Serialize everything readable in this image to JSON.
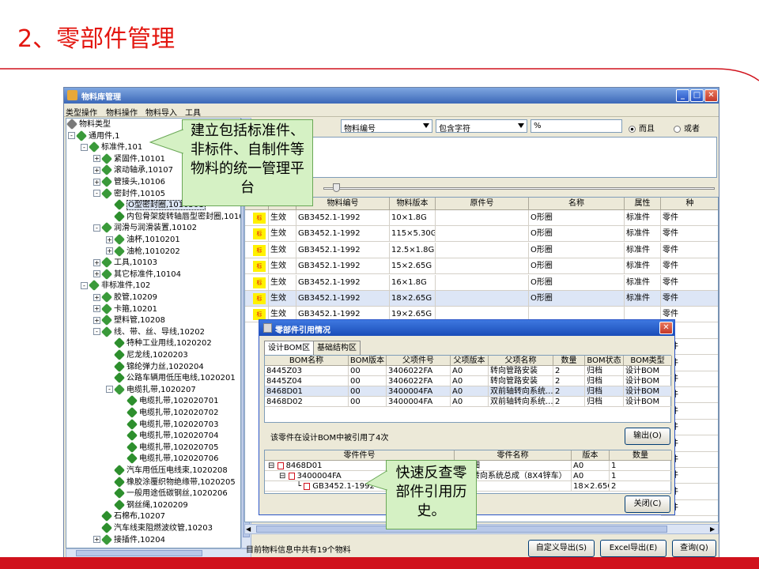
{
  "slide": {
    "title": "2、零部件管理"
  },
  "window": {
    "title": "物料库管理",
    "controls": [
      "_",
      "□",
      "✕"
    ],
    "menu": [
      "类型操作",
      "物料操作",
      "物料导入",
      "工具"
    ]
  },
  "tree": [
    {
      "label": "物料类型",
      "depth": 0,
      "box": "",
      "icon": "root"
    },
    {
      "label": "通用件,1",
      "depth": 0,
      "box": "-",
      "icon": "node"
    },
    {
      "label": "标准件,101",
      "depth": 1,
      "box": "-",
      "icon": "node"
    },
    {
      "label": "紧固件,10101",
      "depth": 2,
      "box": "+",
      "icon": "node"
    },
    {
      "label": "滚动轴承,10107",
      "depth": 2,
      "box": "+",
      "icon": "node"
    },
    {
      "label": "管接头,10106",
      "depth": 2,
      "box": "+",
      "icon": "node"
    },
    {
      "label": "密封件,10105",
      "depth": 2,
      "box": "-",
      "icon": "node"
    },
    {
      "label": "O型密封圈,1010501",
      "depth": 3,
      "box": "",
      "icon": "leaf",
      "selected": true
    },
    {
      "label": "内包骨架旋转轴唇型密封圈,1010502",
      "depth": 3,
      "box": "",
      "icon": "leaf"
    },
    {
      "label": "润滑与润滑装置,10102",
      "depth": 2,
      "box": "-",
      "icon": "node"
    },
    {
      "label": "油杯,1010201",
      "depth": 3,
      "box": "+",
      "icon": "node"
    },
    {
      "label": "油枪,1010202",
      "depth": 3,
      "box": "+",
      "icon": "node"
    },
    {
      "label": "工具,10103",
      "depth": 2,
      "box": "+",
      "icon": "node"
    },
    {
      "label": "其它标准件,10104",
      "depth": 2,
      "box": "+",
      "icon": "node"
    },
    {
      "label": "非标准件,102",
      "depth": 1,
      "box": "-",
      "icon": "node"
    },
    {
      "label": "胶管,10209",
      "depth": 2,
      "box": "+",
      "icon": "node"
    },
    {
      "label": "卡箍,10201",
      "depth": 2,
      "box": "+",
      "icon": "node"
    },
    {
      "label": "塑料管,10208",
      "depth": 2,
      "box": "+",
      "icon": "node"
    },
    {
      "label": "线、带、丝、导线,10202",
      "depth": 2,
      "box": "-",
      "icon": "node"
    },
    {
      "label": "特种工业用线,1020202",
      "depth": 3,
      "box": "",
      "icon": "leaf"
    },
    {
      "label": "尼龙线,1020203",
      "depth": 3,
      "box": "",
      "icon": "leaf"
    },
    {
      "label": "锦纶弹力丝,1020204",
      "depth": 3,
      "box": "",
      "icon": "leaf"
    },
    {
      "label": "公路车辆用低压电线,1020201",
      "depth": 3,
      "box": "",
      "icon": "leaf"
    },
    {
      "label": "电缆扎带,1020207",
      "depth": 3,
      "box": "-",
      "icon": "node"
    },
    {
      "label": "电缆扎带,102020701",
      "depth": 4,
      "box": "",
      "icon": "leaf"
    },
    {
      "label": "电缆扎带,102020702",
      "depth": 4,
      "box": "",
      "icon": "leaf"
    },
    {
      "label": "电缆扎带,102020703",
      "depth": 4,
      "box": "",
      "icon": "leaf"
    },
    {
      "label": "电缆扎带,102020704",
      "depth": 4,
      "box": "",
      "icon": "leaf"
    },
    {
      "label": "电缆扎带,102020705",
      "depth": 4,
      "box": "",
      "icon": "leaf"
    },
    {
      "label": "电缆扎带,102020706",
      "depth": 4,
      "box": "",
      "icon": "leaf"
    },
    {
      "label": "汽车用低压电线束,1020208",
      "depth": 3,
      "box": "",
      "icon": "leaf"
    },
    {
      "label": "橡胶涂覆织物绝缘带,1020205",
      "depth": 3,
      "box": "",
      "icon": "leaf"
    },
    {
      "label": "一般用途低碳钢丝,1020206",
      "depth": 3,
      "box": "",
      "icon": "leaf"
    },
    {
      "label": "钢丝绳,1020209",
      "depth": 3,
      "box": "",
      "icon": "leaf"
    },
    {
      "label": "石棉布,10207",
      "depth": 2,
      "box": "",
      "icon": "leaf"
    },
    {
      "label": "汽车线束阻燃波纹管,10203",
      "depth": 2,
      "box": "",
      "icon": "leaf"
    },
    {
      "label": "接插件,10204",
      "depth": 2,
      "box": "+",
      "icon": "node"
    }
  ],
  "search": {
    "field_select": "物料编号",
    "match_select": "包含字符",
    "value": "%",
    "radio_and": "而且",
    "radio_or": "或者"
  },
  "grid": {
    "headers": [
      "",
      "",
      "物料编号",
      "物料版本",
      "原件号",
      "名称",
      "属性",
      "种"
    ],
    "badge": "标",
    "rows": [
      [
        "生效",
        "GB3452.1-1992",
        "10×1.8G",
        "",
        "O形圈",
        "标准件",
        "零件"
      ],
      [
        "生效",
        "GB3452.1-1992",
        "115×5.30G",
        "",
        "O形圈",
        "标准件",
        "零件"
      ],
      [
        "生效",
        "GB3452.1-1992",
        "12.5×1.8G",
        "",
        "O形圈",
        "标准件",
        "零件"
      ],
      [
        "生效",
        "GB3452.1-1992",
        "15×2.65G",
        "",
        "O形圈",
        "标准件",
        "零件"
      ],
      [
        "生效",
        "GB3452.1-1992",
        "16×1.8G",
        "",
        "O形圈",
        "标准件",
        "零件"
      ],
      [
        "生效",
        "GB3452.1-1992",
        "18×2.65G",
        "",
        "O形圈",
        "标准件",
        "零件"
      ],
      [
        "生效",
        "GB3452.1-1992",
        "19×2.65G",
        "",
        "",
        "",
        "零件"
      ]
    ],
    "extra_cells": [
      "件",
      "零件",
      "零件",
      "零件",
      "零件",
      "零件",
      "零件",
      "零件",
      "零件",
      "零件",
      "零件",
      "零件"
    ]
  },
  "status": {
    "text": "目前物料信息中共有19个物料",
    "btn_custom_export": "自定义导出(S)",
    "btn_excel_export": "Excel导出(E)",
    "btn_query": "查询(Q)"
  },
  "dialog": {
    "title": "零部件引用情况",
    "tabs": [
      "设计BOM区",
      "基础结构区"
    ],
    "headers": [
      "BOM名称",
      "BOM版本",
      "父项件号",
      "父项版本",
      "父项名称",
      "数量",
      "BOM状态",
      "BOM类型"
    ],
    "rows": [
      [
        "8445Z03",
        "00",
        "3406022FA",
        "A0",
        "转向管路安装",
        "2",
        "归档",
        "设计BOM"
      ],
      [
        "8445Z04",
        "00",
        "3406022FA",
        "A0",
        "转向管路安装",
        "2",
        "归档",
        "设计BOM"
      ],
      [
        "8468D01",
        "00",
        "3400004FA",
        "A0",
        "双前轴转向系统...",
        "2",
        "归档",
        "设计BOM"
      ],
      [
        "8468D02",
        "00",
        "3400004FA",
        "A0",
        "双前轴转向系统...",
        "2",
        "归档",
        "设计BOM"
      ]
    ],
    "summary": "该零件在设计BOM中被引用了4次",
    "btn_export": "输出(O)",
    "tree_headers": [
      "零件件号",
      "零件名称",
      "版本",
      "数量"
    ],
    "tree_rows": [
      {
        "part": "8468D01",
        "name": "车明细",
        "ver": "A0",
        "qty": "1"
      },
      {
        "part": "3400004FA",
        "name": "前轴转向系统总成（8X4锌车）",
        "ver": "A0",
        "qty": "1"
      },
      {
        "part": "GB3452.1-1992",
        "name": "",
        "ver": "18×2.65G",
        "qty": "2"
      }
    ],
    "btn_close": "关闭(C)"
  },
  "callouts": {
    "top": "建立包括标准件、非标件、自制件等物料的统一管理平台",
    "bottom": "快速反查零部件引用历史。"
  },
  "colors": {
    "title_red": "#e3160f",
    "callout_fill": "#d5f1c4",
    "titlebar_blue": "#3c68b8"
  }
}
